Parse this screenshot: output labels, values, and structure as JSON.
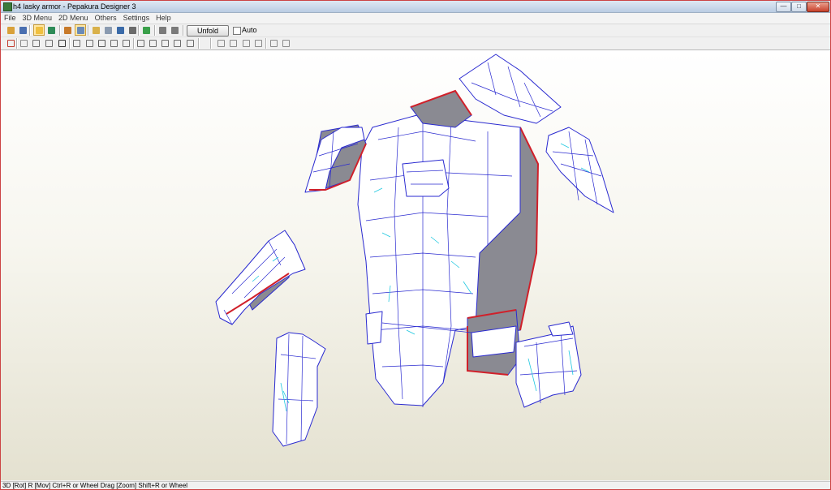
{
  "window": {
    "title": "h4 lasky armor - Pepakura Designer 3",
    "controls": {
      "minimize": "—",
      "maximize": "□",
      "close": "✕"
    }
  },
  "menu": {
    "items": [
      "File",
      "3D Menu",
      "2D Menu",
      "Others",
      "Settings",
      "Help"
    ]
  },
  "toolbar1": {
    "buttons": [
      {
        "icon": "open-folder-icon",
        "color": "#d9a13a"
      },
      {
        "icon": "save-icon",
        "color": "#4a6fb0"
      },
      {
        "icon": "view-3d-icon",
        "color": "#f0c040",
        "active": true
      },
      {
        "icon": "texture-icon",
        "color": "#2e8b57"
      },
      {
        "icon": "edit-icon",
        "color": "#c87a2a"
      },
      {
        "icon": "select-icon",
        "color": "#6a8ab8",
        "active": true
      },
      {
        "icon": "pencil-icon",
        "color": "#d9b14a"
      },
      {
        "icon": "cylinder-icon",
        "color": "#8a9ab0"
      },
      {
        "icon": "move-icon",
        "color": "#3a6aa8"
      },
      {
        "icon": "rotate-icon",
        "color": "#6b6b6b"
      },
      {
        "icon": "cube-icon",
        "color": "#3aa04a"
      },
      {
        "icon": "rectangle-icon",
        "color": "#7a7a7a"
      },
      {
        "icon": "rounded-rect-icon",
        "color": "#7a7a7a"
      }
    ],
    "unfold_label": "Unfold",
    "auto_label": "Auto"
  },
  "toolbar2": {
    "buttons": [
      {
        "icon": "page-setup-icon",
        "color": "#c0392b"
      },
      {
        "icon": "join-edge-icon",
        "color": "#8a8a8a"
      },
      {
        "icon": "grid-icon",
        "color": "#6b6b6b"
      },
      {
        "icon": "fold-line-icon",
        "color": "#6b6b6b"
      },
      {
        "icon": "text-icon",
        "color": "#333333"
      },
      {
        "icon": "glue-flap-icon",
        "color": "#6b6b6b"
      },
      {
        "icon": "page-icon",
        "color": "#6b6b6b"
      },
      {
        "icon": "rectangle-icon",
        "color": "#555555"
      },
      {
        "icon": "undo-icon",
        "color": "#6b6b6b"
      },
      {
        "icon": "redo-icon",
        "color": "#6b6b6b"
      },
      {
        "icon": "frame-icon",
        "color": "#6b6b6b"
      },
      {
        "icon": "align-icon",
        "color": "#6b6b6b"
      },
      {
        "icon": "flip-icon",
        "color": "#6b6b6b"
      },
      {
        "icon": "image-icon",
        "color": "#6b6b6b"
      },
      {
        "icon": "window-icon",
        "color": "#6b6b6b"
      },
      {
        "icon": "align-left-icon",
        "color": "#8a8a8a"
      },
      {
        "icon": "align-center-icon",
        "color": "#8a8a8a"
      },
      {
        "icon": "align-top-icon",
        "color": "#8a8a8a"
      },
      {
        "icon": "align-bottom-icon",
        "color": "#8a8a8a"
      },
      {
        "icon": "zoom-icon",
        "color": "#8a8a8a"
      },
      {
        "icon": "zoom-fit-icon",
        "color": "#8a8a8a"
      }
    ]
  },
  "model": {
    "line_color": "#2a2ad0",
    "cut_color": "#d0202a",
    "fold_color": "#20c8e0",
    "face_color": "#ffffff",
    "inner_color": "#8a8a92"
  },
  "status": {
    "text": "3D [Rot] R [Mov] Ctrl+R or Wheel Drag [Zoom] Shift+R or Wheel"
  }
}
